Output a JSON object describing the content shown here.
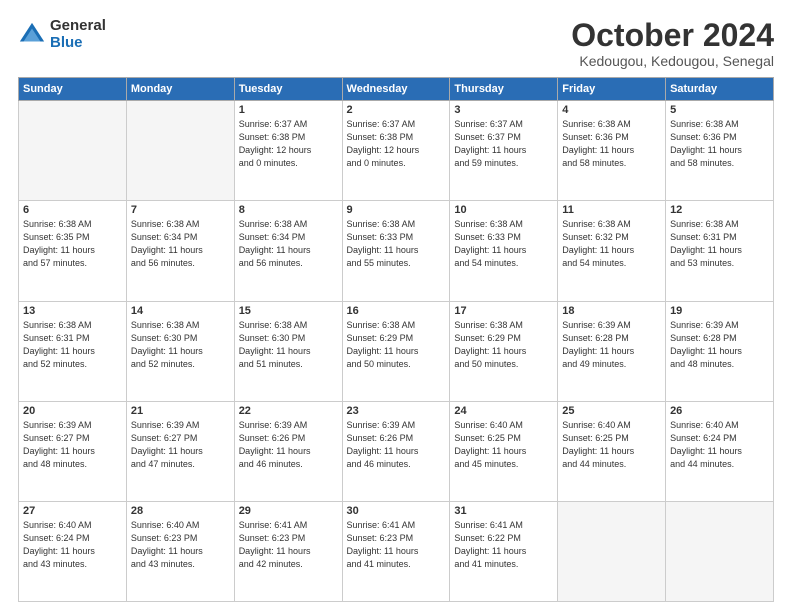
{
  "logo": {
    "general": "General",
    "blue": "Blue"
  },
  "header": {
    "month": "October 2024",
    "location": "Kedougou, Kedougou, Senegal"
  },
  "weekdays": [
    "Sunday",
    "Monday",
    "Tuesday",
    "Wednesday",
    "Thursday",
    "Friday",
    "Saturday"
  ],
  "weeks": [
    [
      {
        "day": "",
        "info": ""
      },
      {
        "day": "",
        "info": ""
      },
      {
        "day": "1",
        "info": "Sunrise: 6:37 AM\nSunset: 6:38 PM\nDaylight: 12 hours\nand 0 minutes."
      },
      {
        "day": "2",
        "info": "Sunrise: 6:37 AM\nSunset: 6:38 PM\nDaylight: 12 hours\nand 0 minutes."
      },
      {
        "day": "3",
        "info": "Sunrise: 6:37 AM\nSunset: 6:37 PM\nDaylight: 11 hours\nand 59 minutes."
      },
      {
        "day": "4",
        "info": "Sunrise: 6:38 AM\nSunset: 6:36 PM\nDaylight: 11 hours\nand 58 minutes."
      },
      {
        "day": "5",
        "info": "Sunrise: 6:38 AM\nSunset: 6:36 PM\nDaylight: 11 hours\nand 58 minutes."
      }
    ],
    [
      {
        "day": "6",
        "info": "Sunrise: 6:38 AM\nSunset: 6:35 PM\nDaylight: 11 hours\nand 57 minutes."
      },
      {
        "day": "7",
        "info": "Sunrise: 6:38 AM\nSunset: 6:34 PM\nDaylight: 11 hours\nand 56 minutes."
      },
      {
        "day": "8",
        "info": "Sunrise: 6:38 AM\nSunset: 6:34 PM\nDaylight: 11 hours\nand 56 minutes."
      },
      {
        "day": "9",
        "info": "Sunrise: 6:38 AM\nSunset: 6:33 PM\nDaylight: 11 hours\nand 55 minutes."
      },
      {
        "day": "10",
        "info": "Sunrise: 6:38 AM\nSunset: 6:33 PM\nDaylight: 11 hours\nand 54 minutes."
      },
      {
        "day": "11",
        "info": "Sunrise: 6:38 AM\nSunset: 6:32 PM\nDaylight: 11 hours\nand 54 minutes."
      },
      {
        "day": "12",
        "info": "Sunrise: 6:38 AM\nSunset: 6:31 PM\nDaylight: 11 hours\nand 53 minutes."
      }
    ],
    [
      {
        "day": "13",
        "info": "Sunrise: 6:38 AM\nSunset: 6:31 PM\nDaylight: 11 hours\nand 52 minutes."
      },
      {
        "day": "14",
        "info": "Sunrise: 6:38 AM\nSunset: 6:30 PM\nDaylight: 11 hours\nand 52 minutes."
      },
      {
        "day": "15",
        "info": "Sunrise: 6:38 AM\nSunset: 6:30 PM\nDaylight: 11 hours\nand 51 minutes."
      },
      {
        "day": "16",
        "info": "Sunrise: 6:38 AM\nSunset: 6:29 PM\nDaylight: 11 hours\nand 50 minutes."
      },
      {
        "day": "17",
        "info": "Sunrise: 6:38 AM\nSunset: 6:29 PM\nDaylight: 11 hours\nand 50 minutes."
      },
      {
        "day": "18",
        "info": "Sunrise: 6:39 AM\nSunset: 6:28 PM\nDaylight: 11 hours\nand 49 minutes."
      },
      {
        "day": "19",
        "info": "Sunrise: 6:39 AM\nSunset: 6:28 PM\nDaylight: 11 hours\nand 48 minutes."
      }
    ],
    [
      {
        "day": "20",
        "info": "Sunrise: 6:39 AM\nSunset: 6:27 PM\nDaylight: 11 hours\nand 48 minutes."
      },
      {
        "day": "21",
        "info": "Sunrise: 6:39 AM\nSunset: 6:27 PM\nDaylight: 11 hours\nand 47 minutes."
      },
      {
        "day": "22",
        "info": "Sunrise: 6:39 AM\nSunset: 6:26 PM\nDaylight: 11 hours\nand 46 minutes."
      },
      {
        "day": "23",
        "info": "Sunrise: 6:39 AM\nSunset: 6:26 PM\nDaylight: 11 hours\nand 46 minutes."
      },
      {
        "day": "24",
        "info": "Sunrise: 6:40 AM\nSunset: 6:25 PM\nDaylight: 11 hours\nand 45 minutes."
      },
      {
        "day": "25",
        "info": "Sunrise: 6:40 AM\nSunset: 6:25 PM\nDaylight: 11 hours\nand 44 minutes."
      },
      {
        "day": "26",
        "info": "Sunrise: 6:40 AM\nSunset: 6:24 PM\nDaylight: 11 hours\nand 44 minutes."
      }
    ],
    [
      {
        "day": "27",
        "info": "Sunrise: 6:40 AM\nSunset: 6:24 PM\nDaylight: 11 hours\nand 43 minutes."
      },
      {
        "day": "28",
        "info": "Sunrise: 6:40 AM\nSunset: 6:23 PM\nDaylight: 11 hours\nand 43 minutes."
      },
      {
        "day": "29",
        "info": "Sunrise: 6:41 AM\nSunset: 6:23 PM\nDaylight: 11 hours\nand 42 minutes."
      },
      {
        "day": "30",
        "info": "Sunrise: 6:41 AM\nSunset: 6:23 PM\nDaylight: 11 hours\nand 41 minutes."
      },
      {
        "day": "31",
        "info": "Sunrise: 6:41 AM\nSunset: 6:22 PM\nDaylight: 11 hours\nand 41 minutes."
      },
      {
        "day": "",
        "info": ""
      },
      {
        "day": "",
        "info": ""
      }
    ]
  ]
}
